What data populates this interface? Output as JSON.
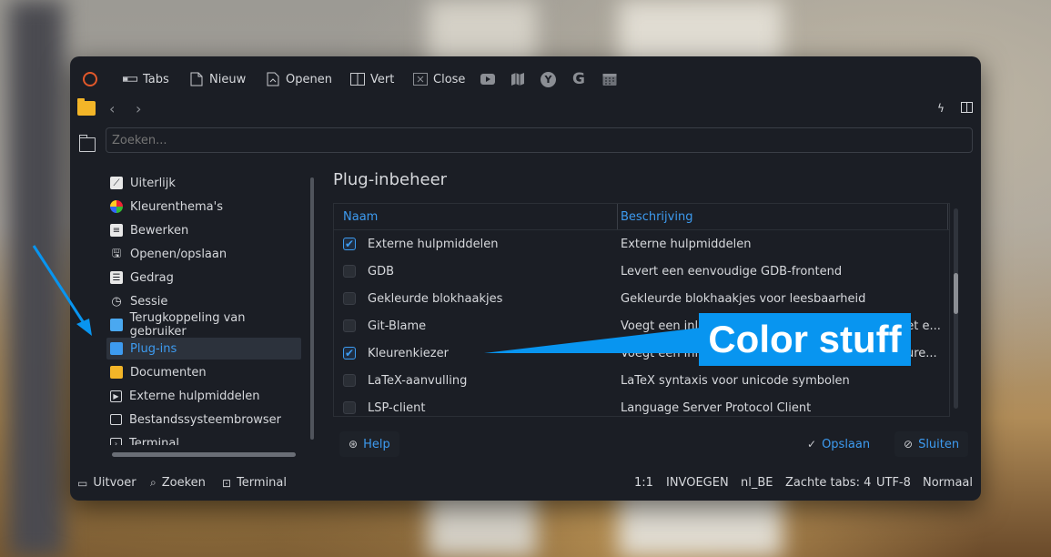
{
  "toolbar": {
    "tabs": "Tabs",
    "new": "Nieuw",
    "open": "Openen",
    "split": "Vert",
    "close": "Close"
  },
  "search": {
    "placeholder": "Zoeken..."
  },
  "sidebar": {
    "items": [
      {
        "label": "Uiterlijk",
        "icon": "appearance-icon"
      },
      {
        "label": "Kleurenthema's",
        "icon": "color-theme-icon"
      },
      {
        "label": "Bewerken",
        "icon": "edit-icon"
      },
      {
        "label": "Openen/opslaan",
        "icon": "save-icon"
      },
      {
        "label": "Gedrag",
        "icon": "behavior-icon"
      },
      {
        "label": "Sessie",
        "icon": "clock-icon"
      },
      {
        "label": "Terugkoppeling van gebruiker",
        "icon": "feedback-icon"
      },
      {
        "label": "Plug-ins",
        "icon": "plugin-icon"
      },
      {
        "label": "Documenten",
        "icon": "folder-icon"
      },
      {
        "label": "Externe hulpmiddelen",
        "icon": "external-tools-icon"
      },
      {
        "label": "Bestandssysteembrowser",
        "icon": "filesystem-icon"
      },
      {
        "label": "Terminal",
        "icon": "terminal-icon"
      }
    ],
    "active_index": 7
  },
  "panel": {
    "title": "Plug-inbeheer",
    "columns": [
      "Naam",
      "Beschrijving"
    ],
    "rows": [
      {
        "name": "Externe hulpmiddelen",
        "desc": "Externe hulpmiddelen",
        "checked": true
      },
      {
        "name": "GDB",
        "desc": "Levert een eenvoudige GDB-frontend",
        "checked": false
      },
      {
        "name": "Gekleurde blokhaakjes",
        "desc": "Gekleurde blokhaakjes voor leesbaarheid",
        "checked": false
      },
      {
        "name": "Git-Blame",
        "desc": "Voegt een inlin",
        "desc_tail": "net e...",
        "checked": false
      },
      {
        "name": "Kleurenkiezer",
        "desc": "Voegt een inlin",
        "desc_tail": "eure...",
        "checked": true
      },
      {
        "name": "LaTeX-aanvulling",
        "desc": "LaTeX syntaxis voor unicode symbolen",
        "checked": false
      },
      {
        "name": "LSP-client",
        "desc": "Language Server Protocol Client",
        "checked": false
      }
    ],
    "help": "Help",
    "save": "Opslaan",
    "close": "Sluiten"
  },
  "statusbar": {
    "output": "Uitvoer",
    "search": "Zoeken",
    "terminal": "Terminal",
    "position": "1:1",
    "mode": "INVOEGEN",
    "language": "nl_BE",
    "indent": "Zachte tabs: 4",
    "encoding": "UTF-8",
    "input_mode": "Normaal"
  },
  "annotation": {
    "callout_text": "Color stuff",
    "color": "#0895f0"
  },
  "colors": {
    "window_bg": "#1b1e25",
    "accent": "#3d9bf0",
    "app_logo": "#e2582a",
    "folder": "#f3b528"
  }
}
